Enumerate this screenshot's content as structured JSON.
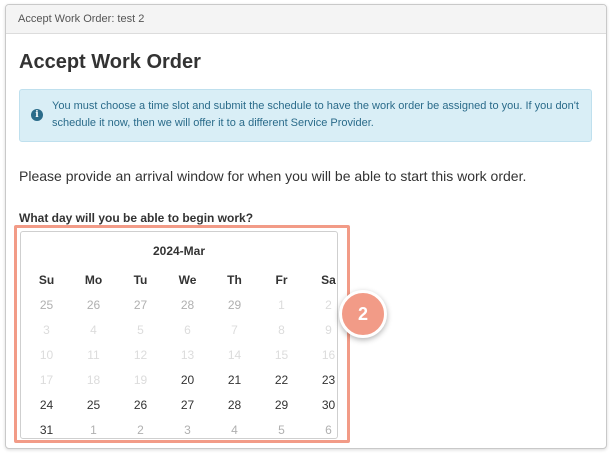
{
  "window": {
    "title": "Accept Work Order: test 2"
  },
  "page": {
    "heading": "Accept Work Order"
  },
  "alert": {
    "icon": "info-icon",
    "icon_glyph": "i",
    "text": "You must choose a time slot and submit the schedule to have the work order be assigned to you. If you don't schedule it now, then we will offer it to a different Service Provider."
  },
  "instruction": "Please provide an arrival window for when you will be able to start this work order.",
  "question": "What day will you be able to begin work?",
  "calendar": {
    "month_label": "2024-Mar",
    "weekdays": [
      "Su",
      "Mo",
      "Tu",
      "We",
      "Th",
      "Fr",
      "Sa"
    ],
    "weeks": [
      [
        {
          "d": "25",
          "s": "muted"
        },
        {
          "d": "26",
          "s": "muted"
        },
        {
          "d": "27",
          "s": "muted"
        },
        {
          "d": "28",
          "s": "muted"
        },
        {
          "d": "29",
          "s": "muted"
        },
        {
          "d": "1",
          "s": "faint"
        },
        {
          "d": "2",
          "s": "faint"
        }
      ],
      [
        {
          "d": "3",
          "s": "faint"
        },
        {
          "d": "4",
          "s": "faint"
        },
        {
          "d": "5",
          "s": "faint"
        },
        {
          "d": "6",
          "s": "faint"
        },
        {
          "d": "7",
          "s": "faint"
        },
        {
          "d": "8",
          "s": "faint"
        },
        {
          "d": "9",
          "s": "faint"
        }
      ],
      [
        {
          "d": "10",
          "s": "faint"
        },
        {
          "d": "11",
          "s": "faint"
        },
        {
          "d": "12",
          "s": "faint"
        },
        {
          "d": "13",
          "s": "faint"
        },
        {
          "d": "14",
          "s": "faint"
        },
        {
          "d": "15",
          "s": "faint"
        },
        {
          "d": "16",
          "s": "faint"
        }
      ],
      [
        {
          "d": "17",
          "s": "faint"
        },
        {
          "d": "18",
          "s": "faint"
        },
        {
          "d": "19",
          "s": "faint"
        },
        {
          "d": "20",
          "s": "active"
        },
        {
          "d": "21",
          "s": "active"
        },
        {
          "d": "22",
          "s": "active"
        },
        {
          "d": "23",
          "s": "active"
        }
      ],
      [
        {
          "d": "24",
          "s": "active"
        },
        {
          "d": "25",
          "s": "active"
        },
        {
          "d": "26",
          "s": "active"
        },
        {
          "d": "27",
          "s": "active"
        },
        {
          "d": "28",
          "s": "active"
        },
        {
          "d": "29",
          "s": "active"
        },
        {
          "d": "30",
          "s": "active"
        }
      ],
      [
        {
          "d": "31",
          "s": "active"
        },
        {
          "d": "1",
          "s": "muted"
        },
        {
          "d": "2",
          "s": "muted"
        },
        {
          "d": "3",
          "s": "muted"
        },
        {
          "d": "4",
          "s": "muted"
        },
        {
          "d": "5",
          "s": "muted"
        },
        {
          "d": "6",
          "s": "muted"
        }
      ]
    ]
  },
  "step_badge": {
    "number": "2"
  },
  "colors": {
    "alert_bg": "#d9eef6",
    "alert_text": "#2a6b8a",
    "highlight": "#f29b87"
  }
}
